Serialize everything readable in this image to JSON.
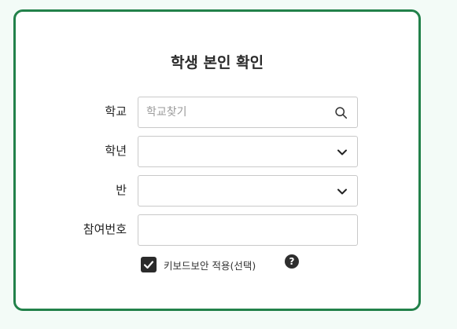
{
  "title": "학생 본인 확인",
  "fields": {
    "school": {
      "label": "학교",
      "placeholder": "학교찾기",
      "value": ""
    },
    "grade": {
      "label": "학년",
      "value": ""
    },
    "class": {
      "label": "반",
      "value": ""
    },
    "participation": {
      "label": "참여번호",
      "value": ""
    }
  },
  "keyboard_security": {
    "label": "키보드보안 적용(선택)",
    "checked": true
  },
  "help_glyph": "?",
  "icons": {
    "search": "search-icon",
    "dropdown": "chevron-down-icon",
    "check": "check-icon",
    "help": "question-circle-icon"
  },
  "colors": {
    "accent_border": "#22814a",
    "page_background": "#f3fbf7",
    "checkbox_fill": "#2b2b2b"
  }
}
